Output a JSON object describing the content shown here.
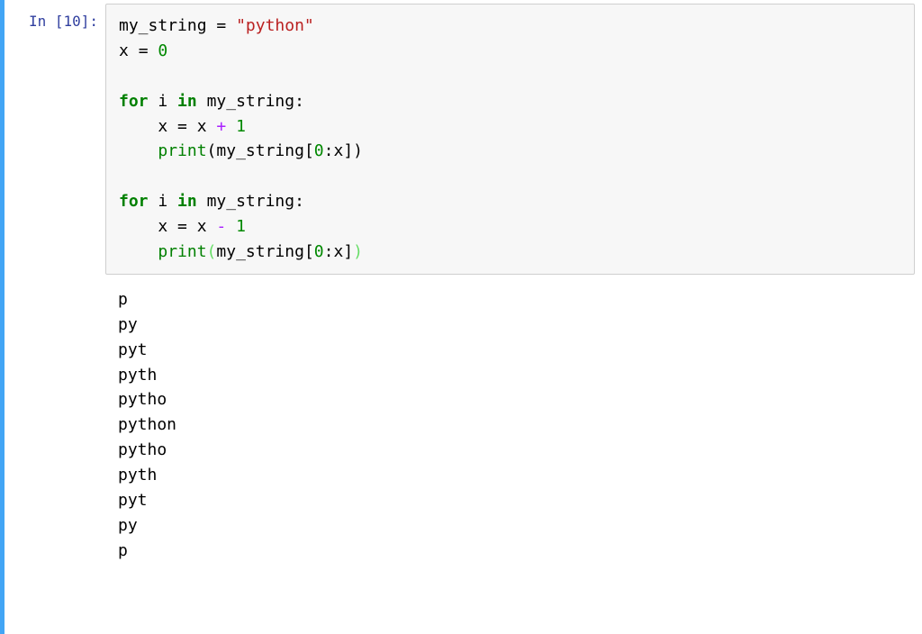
{
  "prompt": "In [10]:",
  "code_tokens": [
    {
      "c": "tok-name",
      "t": "my_string"
    },
    {
      "c": "tok-op",
      "t": " "
    },
    {
      "c": "tok-op",
      "t": "="
    },
    {
      "c": "tok-op",
      "t": " "
    },
    {
      "c": "tok-str",
      "t": "\"python\""
    },
    {
      "c": "",
      "t": "\n"
    },
    {
      "c": "tok-name",
      "t": "x"
    },
    {
      "c": "tok-op",
      "t": " "
    },
    {
      "c": "tok-op",
      "t": "="
    },
    {
      "c": "tok-op",
      "t": " "
    },
    {
      "c": "tok-num",
      "t": "0"
    },
    {
      "c": "",
      "t": "\n"
    },
    {
      "c": "",
      "t": "\n"
    },
    {
      "c": "tok-kw",
      "t": "for"
    },
    {
      "c": "tok-op",
      "t": " "
    },
    {
      "c": "tok-name",
      "t": "i"
    },
    {
      "c": "tok-op",
      "t": " "
    },
    {
      "c": "tok-kw",
      "t": "in"
    },
    {
      "c": "tok-op",
      "t": " "
    },
    {
      "c": "tok-name",
      "t": "my_string"
    },
    {
      "c": "tok-punc",
      "t": ":"
    },
    {
      "c": "",
      "t": "\n"
    },
    {
      "c": "",
      "t": "    "
    },
    {
      "c": "tok-name",
      "t": "x"
    },
    {
      "c": "tok-op",
      "t": " "
    },
    {
      "c": "tok-op",
      "t": "="
    },
    {
      "c": "tok-op",
      "t": " "
    },
    {
      "c": "tok-name",
      "t": "x"
    },
    {
      "c": "tok-op",
      "t": " "
    },
    {
      "c": "tok-opv",
      "t": "+"
    },
    {
      "c": "tok-op",
      "t": " "
    },
    {
      "c": "tok-num",
      "t": "1"
    },
    {
      "c": "",
      "t": "\n"
    },
    {
      "c": "",
      "t": "    "
    },
    {
      "c": "tok-builtin",
      "t": "print"
    },
    {
      "c": "tok-punc",
      "t": "("
    },
    {
      "c": "tok-name",
      "t": "my_string"
    },
    {
      "c": "tok-punc",
      "t": "["
    },
    {
      "c": "tok-num",
      "t": "0"
    },
    {
      "c": "tok-punc",
      "t": ":"
    },
    {
      "c": "tok-name",
      "t": "x"
    },
    {
      "c": "tok-punc",
      "t": "]"
    },
    {
      "c": "tok-punc",
      "t": ")"
    },
    {
      "c": "",
      "t": "\n"
    },
    {
      "c": "",
      "t": "\n"
    },
    {
      "c": "tok-kw",
      "t": "for"
    },
    {
      "c": "tok-op",
      "t": " "
    },
    {
      "c": "tok-name",
      "t": "i"
    },
    {
      "c": "tok-op",
      "t": " "
    },
    {
      "c": "tok-kw",
      "t": "in"
    },
    {
      "c": "tok-op",
      "t": " "
    },
    {
      "c": "tok-name",
      "t": "my_string"
    },
    {
      "c": "tok-punc",
      "t": ":"
    },
    {
      "c": "",
      "t": "\n"
    },
    {
      "c": "",
      "t": "    "
    },
    {
      "c": "tok-name",
      "t": "x"
    },
    {
      "c": "tok-op",
      "t": " "
    },
    {
      "c": "tok-op",
      "t": "="
    },
    {
      "c": "tok-op",
      "t": " "
    },
    {
      "c": "tok-name",
      "t": "x"
    },
    {
      "c": "tok-op",
      "t": " "
    },
    {
      "c": "tok-opv",
      "t": "-"
    },
    {
      "c": "tok-op",
      "t": " "
    },
    {
      "c": "tok-num",
      "t": "1"
    },
    {
      "c": "",
      "t": "\n"
    },
    {
      "c": "",
      "t": "    "
    },
    {
      "c": "tok-builtin",
      "t": "print"
    },
    {
      "c": "tok-curparen",
      "t": "("
    },
    {
      "c": "tok-name",
      "t": "my_string"
    },
    {
      "c": "tok-punc",
      "t": "["
    },
    {
      "c": "tok-num",
      "t": "0"
    },
    {
      "c": "tok-punc",
      "t": ":"
    },
    {
      "c": "tok-name",
      "t": "x"
    },
    {
      "c": "tok-punc",
      "t": "]"
    },
    {
      "c": "tok-curparen",
      "t": ")"
    }
  ],
  "output_lines": [
    "p",
    "py",
    "pyt",
    "pyth",
    "pytho",
    "python",
    "pytho",
    "pyth",
    "pyt",
    "py",
    "p"
  ]
}
